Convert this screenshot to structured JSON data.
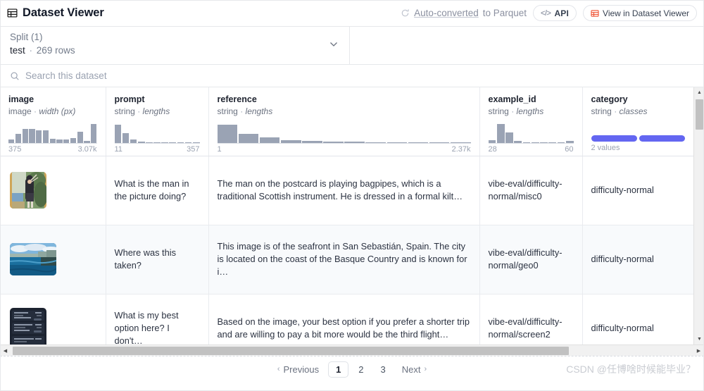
{
  "header": {
    "title": "Dataset Viewer",
    "title_icon": "table-grid-icon",
    "auto_converted_link": "Auto-converted",
    "auto_converted_rest": "to Parquet",
    "refresh_icon": "refresh-icon",
    "api_button": "API",
    "api_icon": "code-brackets-icon",
    "view_button": "View in Dataset Viewer",
    "view_icon": "table-grid-icon-red"
  },
  "split": {
    "label": "Split (1)",
    "name": "test",
    "separator": "·",
    "rows": "269 rows",
    "chevron_icon": "chevron-down-icon"
  },
  "search": {
    "placeholder": "Search this dataset",
    "value": "",
    "icon": "search-icon"
  },
  "columns": [
    {
      "name": "image",
      "type": "image",
      "stat": "width (px)",
      "min": "375",
      "max": "3.07k",
      "hist": [
        0.18,
        0.45,
        0.7,
        0.72,
        0.66,
        0.66,
        0.2,
        0.18,
        0.18,
        0.26,
        0.58,
        0.12,
        0.95
      ]
    },
    {
      "name": "prompt",
      "type": "string",
      "stat": "lengths",
      "min": "11",
      "max": "357",
      "hist": [
        0.92,
        0.5,
        0.18,
        0.07,
        0.05,
        0.05,
        0.05,
        0.05,
        0.0,
        0.05,
        0.05
      ]
    },
    {
      "name": "reference",
      "type": "string",
      "stat": "lengths",
      "min": "1",
      "max": "2.37k",
      "hist": [
        0.92,
        0.45,
        0.28,
        0.14,
        0.09,
        0.07,
        0.06,
        0.05,
        0.05,
        0.05,
        0.04,
        0.04
      ]
    },
    {
      "name": "example_id",
      "type": "string",
      "stat": "lengths",
      "min": "28",
      "max": "60",
      "hist": [
        0.14,
        0.95,
        0.52,
        0.1,
        0.05,
        0.05,
        0.05,
        0.05,
        0.0,
        0.1
      ]
    },
    {
      "name": "category",
      "type": "string",
      "stat": "classes",
      "classes_label": "2 values",
      "class_segments": [
        0.5,
        0.5
      ],
      "class_color": "#6366f1"
    }
  ],
  "rows": [
    {
      "thumbnail": "bagpiper-postcard-thumbnail",
      "prompt": "What is the man in the picture doing?",
      "reference": "The man on the postcard is playing bagpipes, which is a traditional Scottish instrument. He is dressed in a formal kilt…",
      "example_id": "vibe-eval/difficulty-normal/misc0",
      "category": "difficulty-normal"
    },
    {
      "thumbnail": "seafront-coast-thumbnail",
      "prompt": "Where was this taken?",
      "reference": "This image is of the seafront in San Sebastián, Spain. The city is located on the coast of the Basque Country and is known for i…",
      "example_id": "vibe-eval/difficulty-normal/geo0",
      "category": "difficulty-normal"
    },
    {
      "thumbnail": "flight-list-screenshot-thumbnail",
      "prompt": "What is my best option here? I don't…",
      "reference": "Based on the image, your best option if you prefer a shorter trip and are willing to pay a bit more would be the third flight…",
      "example_id": "vibe-eval/difficulty-normal/screen2",
      "category": "difficulty-normal"
    }
  ],
  "pagination": {
    "previous": "Previous",
    "previous_icon": "chevron-left-icon",
    "pages": [
      "1",
      "2",
      "3"
    ],
    "active_page": "1",
    "next": "Next",
    "next_icon": "chevron-right-icon"
  },
  "watermark": "CSDN @任博啥时候能毕业？",
  "scrollbars": {
    "vertical_up_icon": "triangle-up-icon",
    "vertical_down_icon": "triangle-down-icon",
    "horizontal_left_icon": "triangle-left-icon",
    "horizontal_right_icon": "triangle-right-icon"
  }
}
